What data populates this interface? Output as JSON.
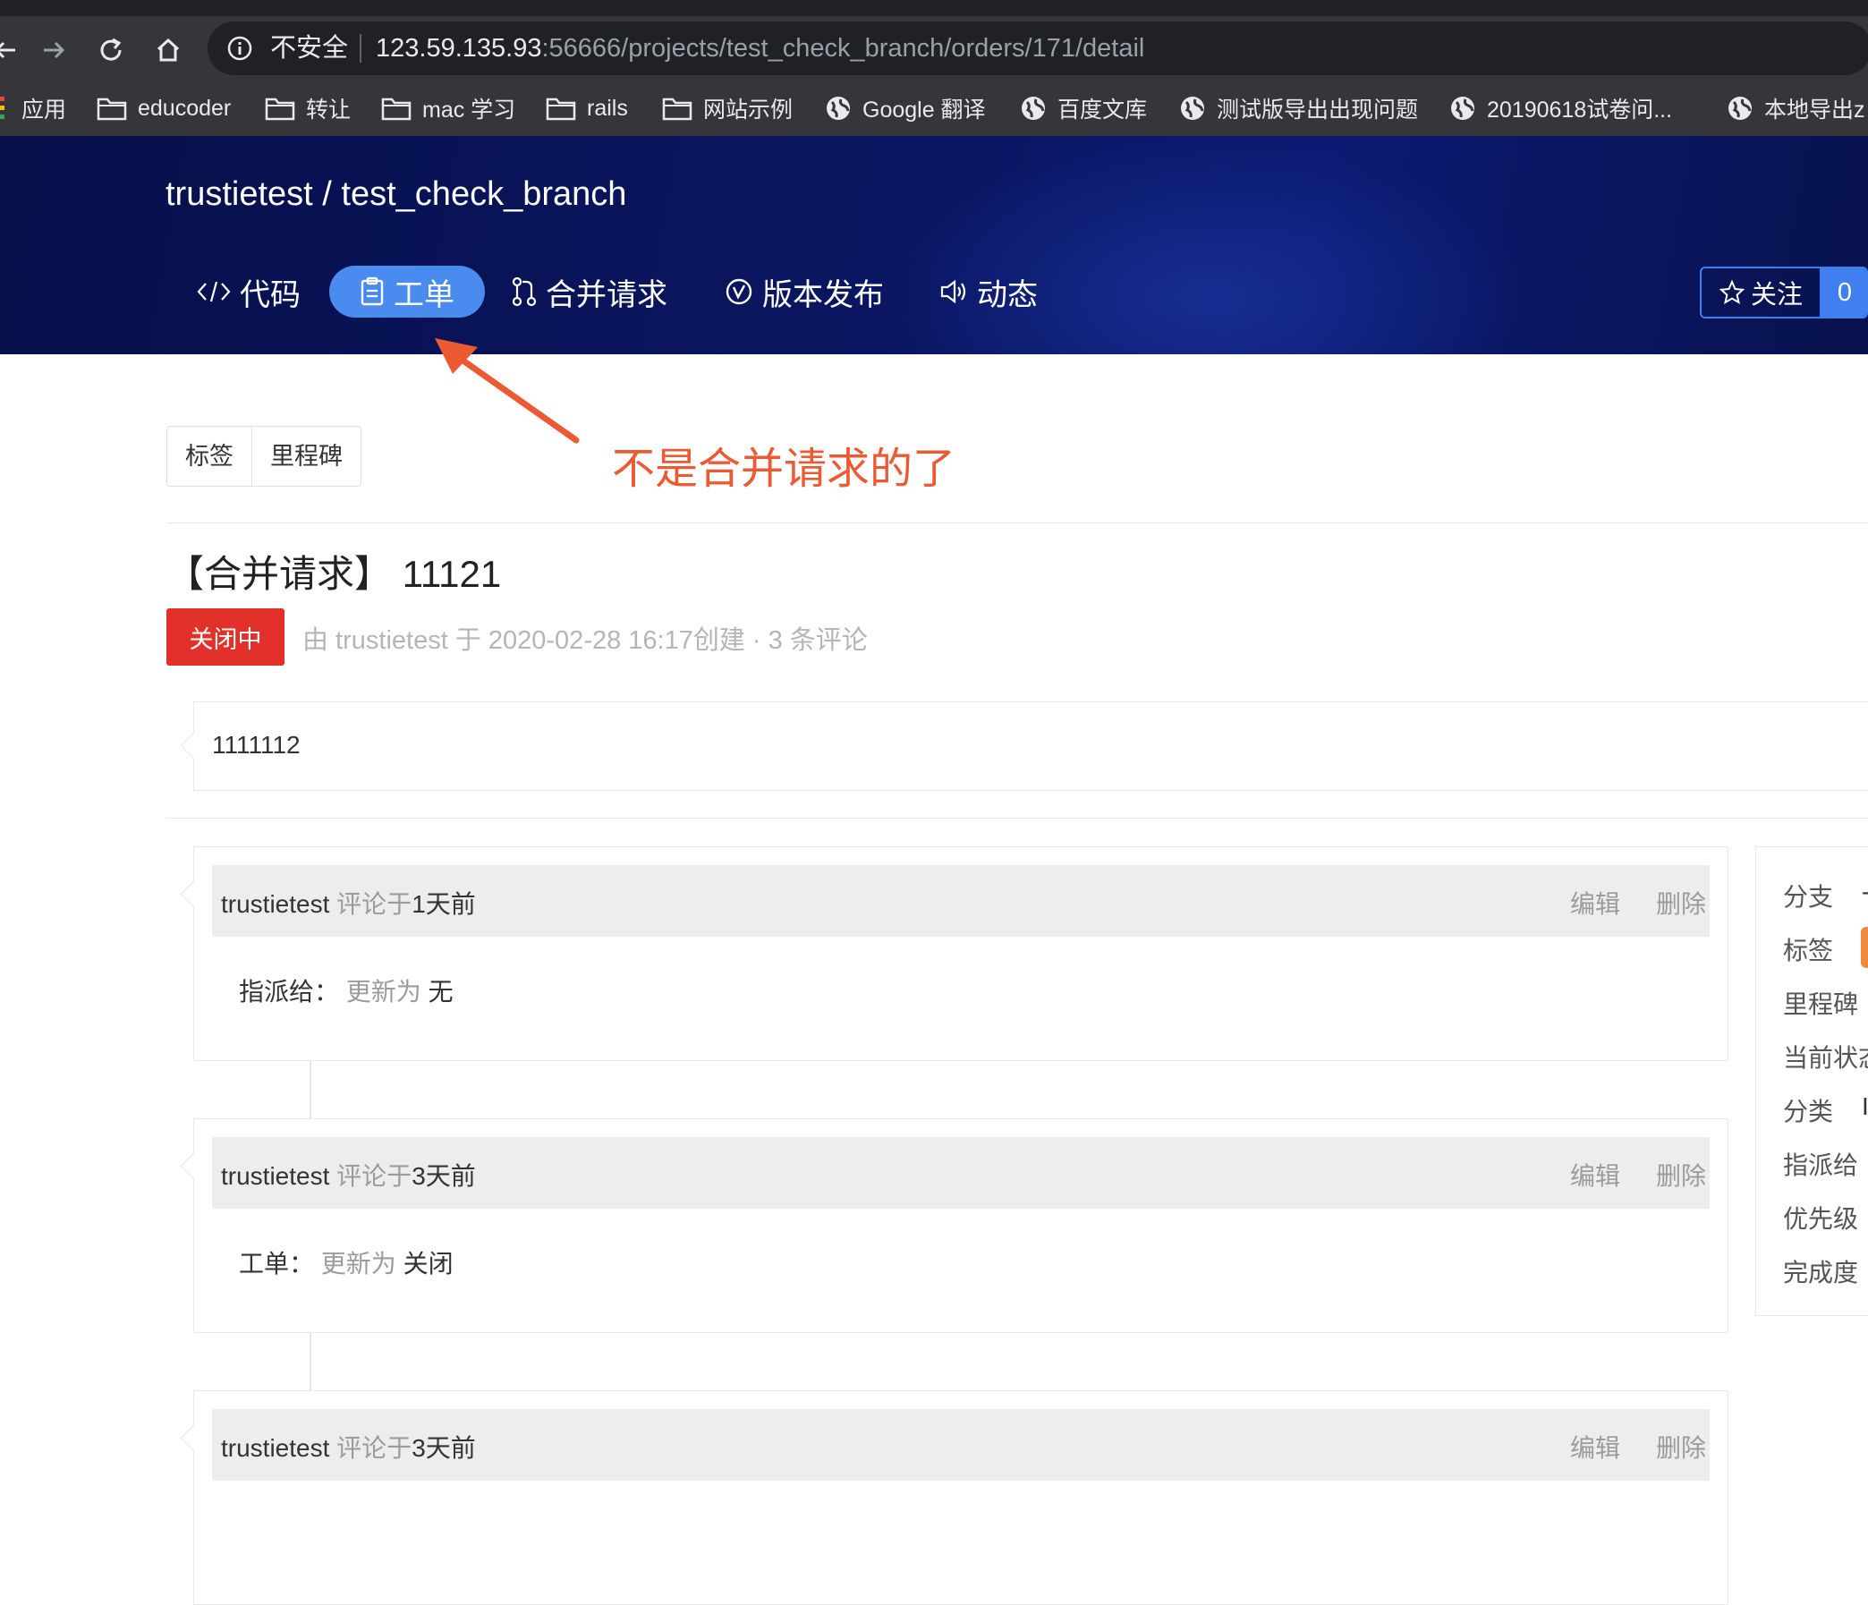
{
  "browser": {
    "security_label": "不安全",
    "url_host": "123.59.135.93",
    "url_rest": ":56666/projects/test_check_branch/orders/171/detail"
  },
  "bookmarks": [
    {
      "label": "应用",
      "icon": "apps-icon"
    },
    {
      "label": "educoder",
      "icon": "folder-icon"
    },
    {
      "label": "转让",
      "icon": "folder-icon"
    },
    {
      "label": "mac 学习",
      "icon": "folder-icon"
    },
    {
      "label": "rails",
      "icon": "folder-icon"
    },
    {
      "label": "网站示例",
      "icon": "folder-icon"
    },
    {
      "label": "Google 翻译",
      "icon": "globe-icon"
    },
    {
      "label": "百度文库",
      "icon": "globe-icon"
    },
    {
      "label": "测试版导出出现问题",
      "icon": "globe-icon"
    },
    {
      "label": "20190618试卷问...",
      "icon": "globe-icon"
    },
    {
      "label": "本地导出z",
      "icon": "globe-icon"
    }
  ],
  "project": {
    "owner": "trustietest",
    "separator": "/",
    "name": "test_check_branch"
  },
  "tabs": [
    {
      "label": "代码",
      "icon": "code-icon"
    },
    {
      "label": "工单",
      "icon": "document-icon",
      "active": true
    },
    {
      "label": "合并请求",
      "icon": "merge-icon"
    },
    {
      "label": "版本发布",
      "icon": "check-circle-icon"
    },
    {
      "label": "动态",
      "icon": "speaker-icon"
    }
  ],
  "watch": {
    "label": "关注",
    "count": "0",
    "icon": "star-icon"
  },
  "filters": {
    "labels": "标签",
    "milestones": "里程碑"
  },
  "annotation": {
    "text": "不是合并请求的了",
    "color": "#ec5a34"
  },
  "order": {
    "title": "【合并请求】 11121",
    "status": "关闭中",
    "meta": "由 trustietest 于 2020-02-28 16:17创建 · 3 条评论",
    "description": "1111112"
  },
  "comments": [
    {
      "author": "trustietest",
      "action": "评论于",
      "time": "1天前",
      "edit": "编辑",
      "delete": "删除",
      "field": "指派给：",
      "verb": "更新为",
      "value": "无"
    },
    {
      "author": "trustietest",
      "action": "评论于",
      "time": "3天前",
      "edit": "编辑",
      "delete": "删除",
      "field": "工单：",
      "verb": "更新为",
      "value": "关闭"
    },
    {
      "author": "trustietest",
      "action": "评论于",
      "time": "3天前",
      "edit": "编辑",
      "delete": "删除"
    }
  ],
  "sidebar": {
    "labels": [
      "分支",
      "标签",
      "里程碑",
      "当前状态",
      "分类",
      "指派给",
      "优先级",
      "完成度"
    ],
    "branch_value": "-",
    "category_value": "I"
  },
  "colors": {
    "header_bg": "#0a1660",
    "active_tab": "#4a8bf0",
    "status_closed": "#e2302a",
    "watch_accent": "#3f7ff0"
  }
}
